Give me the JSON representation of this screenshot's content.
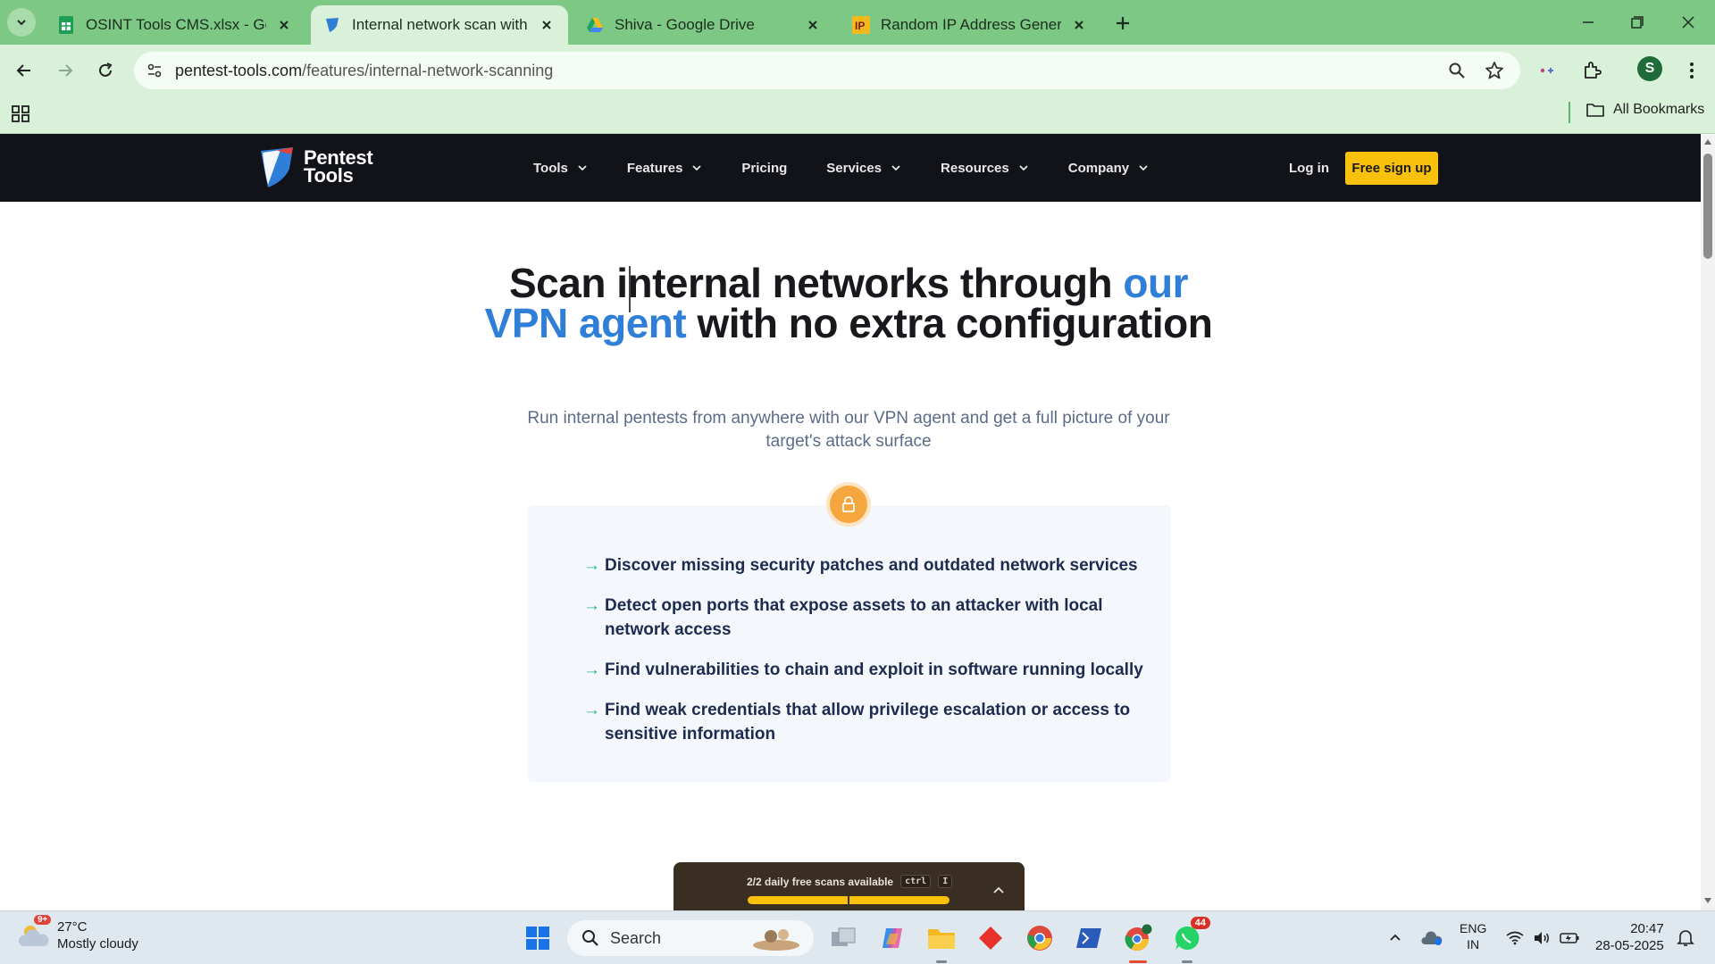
{
  "browser": {
    "tabs": [
      {
        "title": "OSINT Tools CMS.xlsx - Google",
        "favicon": "sheets-icon",
        "active": false
      },
      {
        "title": "Internal network scan with the P",
        "favicon": "pentest-tools-favicon",
        "active": true
      },
      {
        "title": "Shiva - Google Drive",
        "favicon": "drive-icon",
        "active": false
      },
      {
        "title": "Random IP Address Generator,",
        "favicon": "ip-icon",
        "active": false
      }
    ],
    "url_host": "pentest-tools.com",
    "url_path": "/features/internal-network-scanning",
    "profile_initial": "S",
    "bookmarks_label": "All Bookmarks",
    "accent": "#7cc884"
  },
  "site": {
    "logo_line1": "Pentest",
    "logo_line2": "Tools",
    "nav": [
      {
        "label": "Tools",
        "has_menu": true
      },
      {
        "label": "Features",
        "has_menu": true
      },
      {
        "label": "Pricing",
        "has_menu": false
      },
      {
        "label": "Services",
        "has_menu": true
      },
      {
        "label": "Resources",
        "has_menu": true
      },
      {
        "label": "Company",
        "has_menu": true
      }
    ],
    "login": "Log in",
    "signup": "Free sign up",
    "cta_color": "#f9c10b"
  },
  "hero": {
    "title_part1": "Scan internal networks through ",
    "title_highlight": "our VPN agent",
    "title_part2": " with no extra configuration",
    "subtitle": "Run internal pentests from anywhere with our VPN agent and get a full picture of your target's attack surface"
  },
  "features": [
    "Discover missing security patches and outdated network services",
    "Detect open ports that expose assets to an attacker with local network access",
    "Find vulnerabilities to chain and exploit in software running locally",
    "Find weak credentials that allow privilege escalation or access to sensitive information"
  ],
  "scan_panel": {
    "text": "2/2 daily free scans available",
    "key1": "ctrl",
    "key2": "I",
    "progress": 1.0
  },
  "taskbar": {
    "weather_temp": "27°C",
    "weather_desc": "Mostly cloudy",
    "weather_badge": "9+",
    "search_label": "Search",
    "whatsapp_badge": "44",
    "lang_line1": "ENG",
    "lang_line2": "IN",
    "time": "20:47",
    "date": "28-05-2025"
  }
}
